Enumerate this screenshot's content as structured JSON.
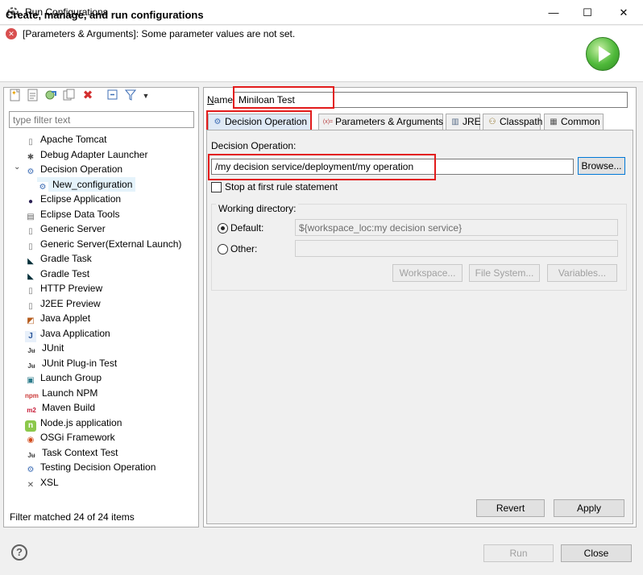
{
  "window": {
    "title": "Run Configurations",
    "minimize": "—",
    "maximize": "☐",
    "close": "✕"
  },
  "header": {
    "title": "Create, manage, and run configurations",
    "error_message": "[Parameters & Arguments]: Some parameter values are not set."
  },
  "left": {
    "filter_placeholder": "type filter text",
    "filter_status": "Filter matched 24 of 24 items",
    "tree": [
      {
        "label": "Apache Tomcat",
        "icon": "file-icon",
        "level": 0
      },
      {
        "label": "Debug Adapter Launcher",
        "icon": "bug-icon",
        "level": 0
      },
      {
        "label": "Decision Operation",
        "icon": "decision-icon",
        "level": 0,
        "expanded": true
      },
      {
        "label": "New_configuration",
        "icon": "decision-icon",
        "level": 1,
        "selected": true
      },
      {
        "label": "Eclipse Application",
        "icon": "eclipse-icon",
        "level": 0
      },
      {
        "label": "Eclipse Data Tools",
        "icon": "data-icon",
        "level": 0
      },
      {
        "label": "Generic Server",
        "icon": "file-icon",
        "level": 0
      },
      {
        "label": "Generic Server(External Launch)",
        "icon": "file-icon",
        "level": 0
      },
      {
        "label": "Gradle Task",
        "icon": "gradle-icon",
        "level": 0
      },
      {
        "label": "Gradle Test",
        "icon": "gradle-icon",
        "level": 0
      },
      {
        "label": "HTTP Preview",
        "icon": "file-icon",
        "level": 0
      },
      {
        "label": "J2EE Preview",
        "icon": "file-icon",
        "level": 0
      },
      {
        "label": "Java Applet",
        "icon": "applet-icon",
        "level": 0
      },
      {
        "label": "Java Application",
        "icon": "java-icon",
        "level": 0
      },
      {
        "label": "JUnit",
        "icon": "junit-icon",
        "level": 0
      },
      {
        "label": "JUnit Plug-in Test",
        "icon": "junit-icon",
        "level": 0
      },
      {
        "label": "Launch Group",
        "icon": "launch-group-icon",
        "level": 0
      },
      {
        "label": "Launch NPM",
        "icon": "npm-icon",
        "level": 0
      },
      {
        "label": "Maven Build",
        "icon": "maven-icon",
        "level": 0
      },
      {
        "label": "Node.js application",
        "icon": "nodejs-icon",
        "level": 0
      },
      {
        "label": "OSGi Framework",
        "icon": "osgi-icon",
        "level": 0
      },
      {
        "label": "Task Context Test",
        "icon": "junit-icon",
        "level": 0
      },
      {
        "label": "Testing Decision Operation",
        "icon": "decision-icon",
        "level": 0
      },
      {
        "label": "XSL",
        "icon": "xsl-icon",
        "level": 0
      }
    ]
  },
  "right": {
    "name_label": "Name:",
    "name_value": "Miniloan Test",
    "tabs": [
      {
        "label": "Decision Operation",
        "icon": "decision-icon",
        "active": true
      },
      {
        "label": "Parameters & Arguments",
        "icon": "arguments-icon",
        "active": false
      },
      {
        "label": "JRE",
        "icon": "jre-icon",
        "active": false
      },
      {
        "label": "Classpath",
        "icon": "classpath-icon",
        "active": false
      },
      {
        "label": "Common",
        "icon": "common-icon",
        "active": false
      }
    ],
    "decision_label": "Decision Operation:",
    "decision_value": "/my decision service/deployment/my operation",
    "browse_label": "Browse...",
    "stop_label": "Stop at first rule statement",
    "working_dir_label": "Working directory:",
    "default_label": "Default:",
    "default_value": "${workspace_loc:my decision service}",
    "other_label": "Other:",
    "workspace_label": "Workspace...",
    "filesystem_label": "File System...",
    "variables_label": "Variables...",
    "revert_label": "Revert",
    "apply_label": "Apply"
  },
  "footer": {
    "help": "?",
    "run_label": "Run",
    "close_label": "Close"
  },
  "colors": {
    "highlight": "#e21b1b",
    "error": "#d84f4f",
    "run_green": "#4fb93a"
  }
}
